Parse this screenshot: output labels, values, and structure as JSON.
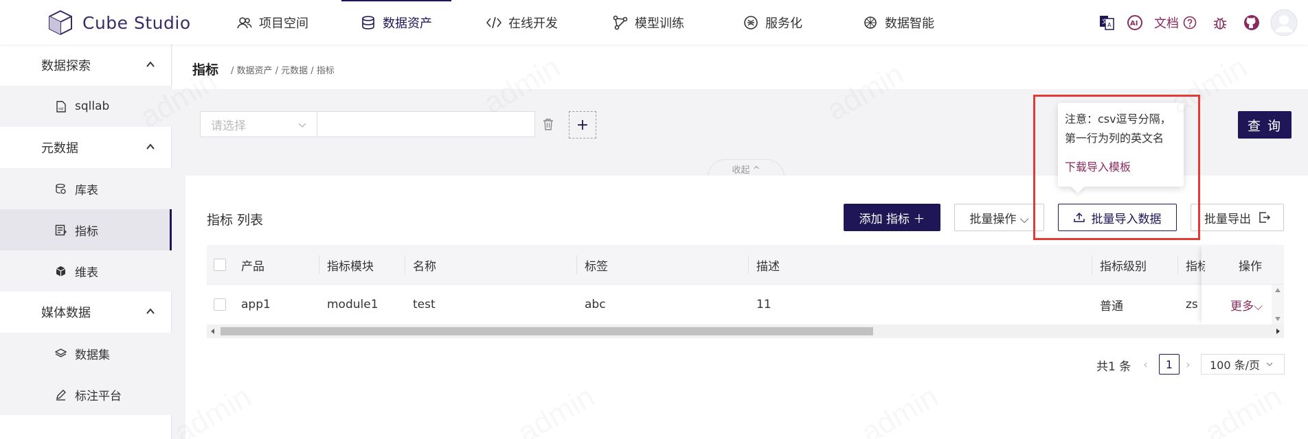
{
  "app": {
    "name": "Cube Studio"
  },
  "nav": {
    "items": [
      {
        "label": "项目空间",
        "icon": "users-icon"
      },
      {
        "label": "数据资产",
        "icon": "database-icon",
        "active": true
      },
      {
        "label": "在线开发",
        "icon": "code-icon"
      },
      {
        "label": "模型训练",
        "icon": "model-icon"
      },
      {
        "label": "服务化",
        "icon": "service-icon"
      },
      {
        "label": "数据智能",
        "icon": "ai-icon"
      }
    ],
    "docs_label": "文档",
    "ai_label": "AI"
  },
  "sidebar": {
    "groups": [
      {
        "label": "数据探索",
        "items": [
          {
            "label": "sqllab",
            "icon": "sql-file-icon"
          }
        ]
      },
      {
        "label": "元数据",
        "items": [
          {
            "label": "库表",
            "icon": "table-icon"
          },
          {
            "label": "指标",
            "icon": "metric-icon",
            "active": true
          },
          {
            "label": "维表",
            "icon": "dimension-icon"
          }
        ]
      },
      {
        "label": "媒体数据",
        "items": [
          {
            "label": "数据集",
            "icon": "layers-icon"
          },
          {
            "label": "标注平台",
            "icon": "pen-icon"
          }
        ]
      }
    ]
  },
  "page": {
    "title": "指标",
    "breadcrumb": "/ 数据资产 / 元数据 / 指标"
  },
  "filter": {
    "select_placeholder": "请选择",
    "query_label": "查 询",
    "collapse_label": "收起 ^"
  },
  "list": {
    "title": "指标 列表",
    "add_label": "添加 指标 ＋",
    "batch_label": "批量操作 ⌵",
    "import_label": "批量导入数据",
    "export_label": "批量导出",
    "columns": [
      "产品",
      "指标模块",
      "名称",
      "标签",
      "描述",
      "指标级别",
      "指标",
      "操作"
    ],
    "rows": [
      {
        "product": "app1",
        "module": "module1",
        "name": "test",
        "tag": "abc",
        "desc": "11",
        "level": "普通",
        "owner": "zs",
        "action": "更多⌵"
      }
    ]
  },
  "pagination": {
    "total": "共1 条",
    "current": "1",
    "page_size": "100 条/页"
  },
  "tooltip": {
    "line1": "注意：csv逗号分隔，",
    "line2": "第一行为列的英文名",
    "link": "下载导入模板"
  },
  "watermark": "admin",
  "colors": {
    "primary": "#1e1656",
    "link": "#8a2a5e",
    "highlight": "#e53935"
  }
}
